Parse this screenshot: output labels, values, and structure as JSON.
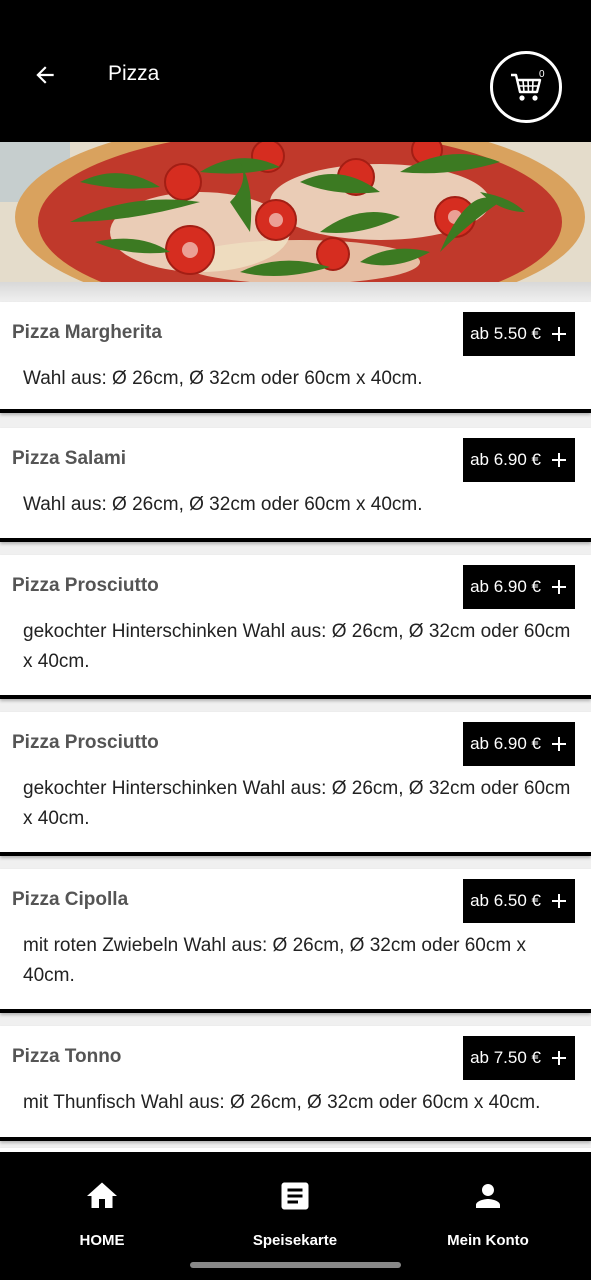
{
  "header": {
    "title": "Pizza",
    "cart_count": "0",
    "icons": {
      "back": "arrow-left-icon",
      "cart": "shopping-cart-icon"
    }
  },
  "banner": {
    "image": "pizza-banner"
  },
  "products": [
    {
      "name": "Pizza Margherita",
      "price": "ab 5.50 €",
      "desc": "Wahl aus: Ø 26cm, Ø 32cm oder 60cm x 40cm."
    },
    {
      "name": "Pizza Salami",
      "price": "ab 6.90 €",
      "desc": "Wahl aus: Ø 26cm, Ø 32cm oder 60cm x 40cm."
    },
    {
      "name": "Pizza Prosciutto",
      "price": "ab 6.90 €",
      "desc": "gekochter Hinterschinken Wahl aus: Ø 26cm, Ø 32cm oder 60cm x 40cm."
    },
    {
      "name": "Pizza Prosciutto",
      "price": "ab 6.90 €",
      "desc": "gekochter Hinterschinken Wahl aus: Ø 26cm, Ø 32cm oder 60cm x 40cm."
    },
    {
      "name": "Pizza Cipolla",
      "price": "ab 6.50 €",
      "desc": "mit roten Zwiebeln Wahl aus: Ø 26cm, Ø 32cm oder 60cm x 40cm."
    },
    {
      "name": "Pizza Tonno",
      "price": "ab 7.50 €",
      "desc": "mit Thunfisch Wahl aus: Ø 26cm, Ø 32cm oder 60cm x 40cm."
    }
  ],
  "nav": {
    "home": {
      "label": "HOME",
      "icon": "home-icon"
    },
    "menu": {
      "label": "Speisekarte",
      "icon": "menu-list-icon"
    },
    "account": {
      "label": "Mein Konto",
      "icon": "user-icon"
    }
  },
  "colors": {
    "header_bg": "#000000",
    "card_bg": "#ffffff",
    "name_text": "#555555"
  }
}
